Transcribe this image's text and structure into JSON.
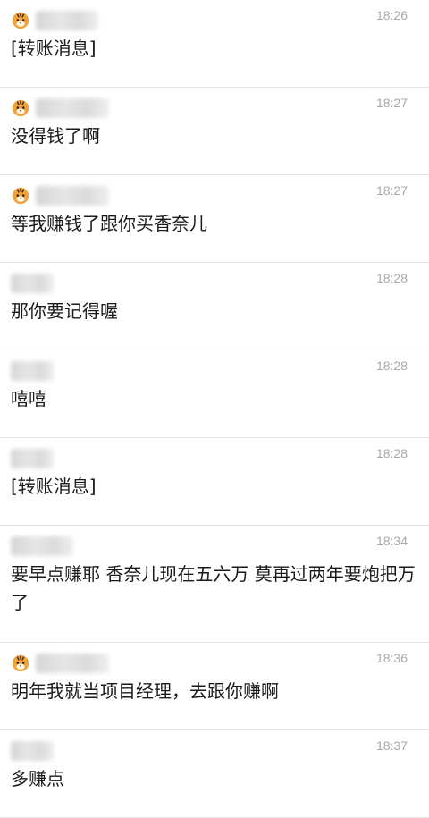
{
  "messages": [
    {
      "time": "18:26",
      "text": "[转账消息]",
      "avatar": "tiger"
    },
    {
      "time": "18:27",
      "text": "没得钱了啊",
      "avatar": "tiger"
    },
    {
      "time": "18:27",
      "text": "等我赚钱了跟你买香奈儿",
      "avatar": "tiger"
    },
    {
      "time": "18:28",
      "text": "那你要记得喔",
      "avatar": "none"
    },
    {
      "time": "18:28",
      "text": "嘻嘻",
      "avatar": "none"
    },
    {
      "time": "18:28",
      "text": "[转账消息]",
      "avatar": "none"
    },
    {
      "time": "18:34",
      "text": "要早点赚耶 香奈儿现在五六万 莫再过两年要炮把万了",
      "avatar": "none"
    },
    {
      "time": "18:36",
      "text": "明年我就当项目经理，去跟你赚啊",
      "avatar": "tiger"
    },
    {
      "time": "18:37",
      "text": "多赚点",
      "avatar": "none"
    }
  ]
}
